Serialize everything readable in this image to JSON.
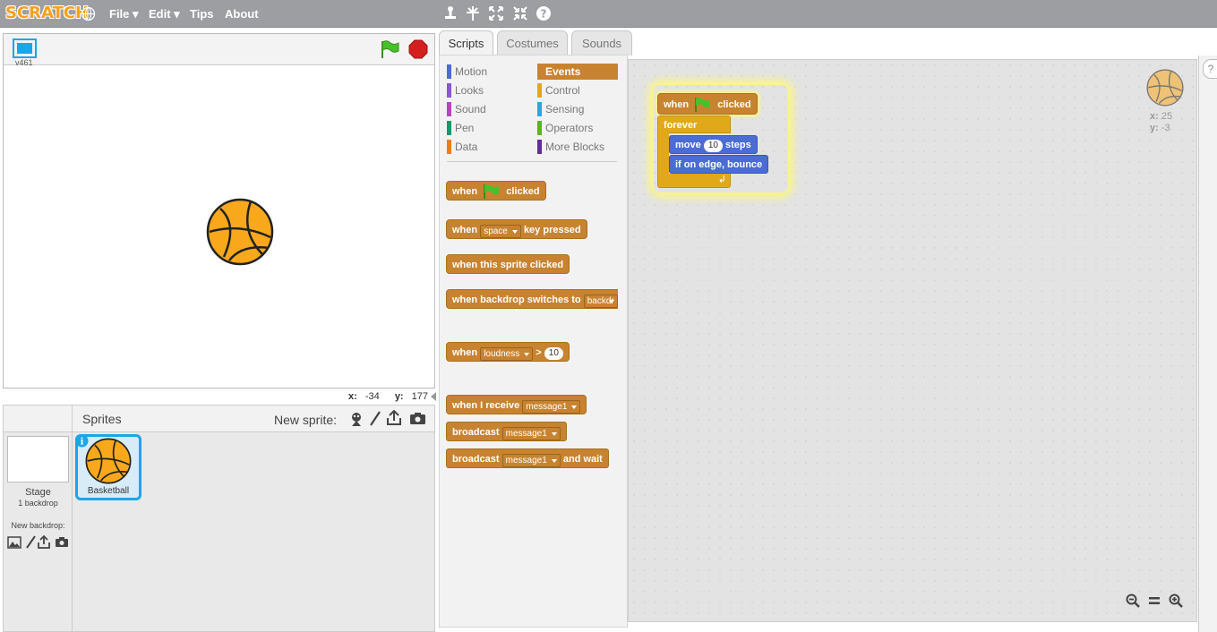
{
  "menubar": {
    "logo": "SCRATCH",
    "menus": [
      "File",
      "Edit",
      "Tips",
      "About"
    ]
  },
  "stage": {
    "version": "v461",
    "mouse_x_label": "x:",
    "mouse_x": "-34",
    "mouse_y_label": "y:",
    "mouse_y": "177"
  },
  "sprites_pane": {
    "title": "Sprites",
    "new_sprite_label": "New sprite:",
    "stage_label": "Stage",
    "backdrop_count": "1 backdrop",
    "new_backdrop_label": "New backdrop:",
    "sprite_name": "Basketball"
  },
  "tabs": [
    "Scripts",
    "Costumes",
    "Sounds"
  ],
  "categories": [
    {
      "name": "Motion",
      "color": "#4a6cd4"
    },
    {
      "name": "Looks",
      "color": "#8a55d7"
    },
    {
      "name": "Sound",
      "color": "#bb42c3"
    },
    {
      "name": "Pen",
      "color": "#0e9a6c"
    },
    {
      "name": "Data",
      "color": "#ee7d16"
    },
    {
      "name": "Events",
      "color": "#c88330"
    },
    {
      "name": "Control",
      "color": "#e1a91a"
    },
    {
      "name": "Sensing",
      "color": "#2ca5e2"
    },
    {
      "name": "Operators",
      "color": "#5cb712"
    },
    {
      "name": "More Blocks",
      "color": "#632d99"
    }
  ],
  "palette_blocks": {
    "flag_when": "when",
    "flag_clicked": "clicked",
    "key_when": "when",
    "key_value": "space",
    "key_pressed": "key pressed",
    "sprite_clicked": "when this sprite clicked",
    "backdrop_when": "when backdrop switches to",
    "backdrop_value": "backdr",
    "loudness_when": "when",
    "loudness_value": "loudness",
    "loudness_op": ">",
    "loudness_num": "10",
    "receive_when": "when I receive",
    "receive_value": "message1",
    "broadcast": "broadcast",
    "broadcast_value": "message1",
    "broadcast_wait": "broadcast",
    "broadcast_wait_value": "message1",
    "and_wait": "and wait"
  },
  "script": {
    "hat_when": "when",
    "hat_clicked": "clicked",
    "forever": "forever",
    "move": "move",
    "move_steps": "10",
    "steps": "steps",
    "bounce": "if on edge, bounce"
  },
  "sprite_info": {
    "x_label": "x:",
    "x": "25",
    "y_label": "y:",
    "y": "-3"
  }
}
